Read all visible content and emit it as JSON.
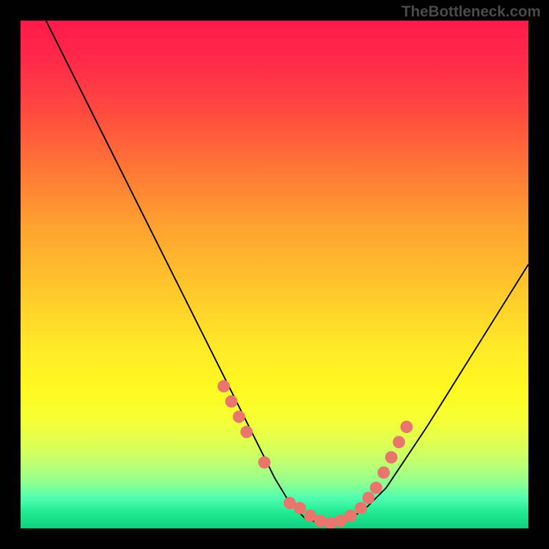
{
  "watermark": "TheBottleneck.com",
  "chart_data": {
    "type": "line",
    "title": "",
    "xlabel": "",
    "ylabel": "",
    "xlim": [
      0,
      100
    ],
    "ylim": [
      0,
      100
    ],
    "grid": false,
    "legend": false,
    "series": [
      {
        "name": "bottleneck-curve",
        "x": [
          5,
          10,
          15,
          20,
          25,
          30,
          35,
          40,
          45,
          50,
          53,
          56,
          59,
          62,
          65,
          68,
          72,
          76,
          80,
          85,
          90,
          95,
          100
        ],
        "y": [
          100,
          90,
          80,
          70,
          60,
          50,
          40,
          30,
          20,
          10,
          5,
          2,
          1,
          1,
          2,
          4,
          8,
          14,
          20,
          28,
          36,
          44,
          52
        ]
      }
    ],
    "dots": {
      "name": "highlight-dots",
      "color": "#e8766c",
      "x": [
        40,
        41.5,
        43,
        44.5,
        48,
        53,
        55,
        57,
        59,
        61,
        63,
        65,
        67,
        68.5,
        70,
        71.5,
        73,
        74.5,
        76
      ],
      "y": [
        28,
        25,
        22,
        19,
        13,
        5,
        4,
        2.5,
        1.5,
        1,
        1.5,
        2.5,
        4,
        6,
        8,
        11,
        14,
        17,
        20
      ]
    },
    "gradient": {
      "description": "vertical red-to-green heat gradient background",
      "stops": [
        "#ff1a4a",
        "#ffe828",
        "#10d080"
      ]
    }
  }
}
